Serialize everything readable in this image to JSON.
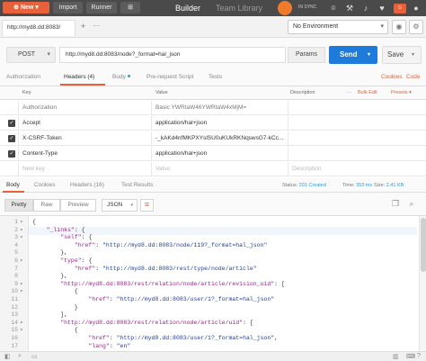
{
  "topbar": {
    "new_label": "New",
    "import_label": "Import",
    "runner_label": "Runner",
    "newtab_label": "⊞",
    "builder_label": "Builder",
    "team_library_label": "Team Library",
    "sync_label": "IN SYNC"
  },
  "request_tab": {
    "label": "http://myd8.dd:8083/",
    "add_label": "+",
    "more_label": "···"
  },
  "environment": {
    "selected": "No Environment"
  },
  "request": {
    "method": "POST",
    "url": "http://myd8.dd:8083/node?_format=hal_json",
    "params_label": "Params",
    "send_label": "Send",
    "save_label": "Save"
  },
  "request_tabs": {
    "authorization": "Authorization",
    "headers": "Headers (4)",
    "body": "Body",
    "prerequest": "Pre-request Script",
    "tests": "Tests",
    "cookies": "Cookies",
    "code": "Code"
  },
  "headers_table": {
    "col_key": "Key",
    "col_value": "Value",
    "col_description": "Description",
    "more": "···",
    "bulk_edit": "Bulk Edit",
    "presets": "Presets ▾",
    "rows": [
      {
        "key": "Authorization",
        "value": "Basic YWRtaW46YWRtaW4xMjM=",
        "checked": false
      },
      {
        "key": "Accept",
        "value": "application/hal+json",
        "checked": true
      },
      {
        "key": "X-CSRF-Token",
        "value": "-_kAKd4nfMKPXYslSU0uKUkRKNqswsG7-kCc...",
        "checked": true
      },
      {
        "key": "Content-Type",
        "value": "application/hal+json",
        "checked": true
      }
    ],
    "placeholder_key": "New key",
    "placeholder_value": "Value",
    "placeholder_description": "Description"
  },
  "response_tabs": {
    "body": "Body",
    "cookies": "Cookies",
    "headers": "Headers (16)",
    "tests": "Test Results",
    "status_label": "Status:",
    "status_value": "201 Created",
    "time_label": "Time:",
    "time_value": "353 ms",
    "size_label": "Size:",
    "size_value": "2.41 KB"
  },
  "response_toolbar": {
    "pretty": "Pretty",
    "raw": "Raw",
    "preview": "Preview",
    "format": "JSON"
  },
  "code_lines": [
    {
      "n": "1",
      "fold": "▾",
      "text": "{"
    },
    {
      "n": "2",
      "fold": "▾",
      "text": "    \"_links\": {"
    },
    {
      "n": "3",
      "fold": "▾",
      "text": "        \"self\": {"
    },
    {
      "n": "4",
      "fold": "",
      "text": "            \"href\": \"http://myd8.dd:8083/node/119?_format=hal_json\""
    },
    {
      "n": "5",
      "fold": "",
      "text": "        },"
    },
    {
      "n": "6",
      "fold": "▾",
      "text": "        \"type\": {"
    },
    {
      "n": "7",
      "fold": "",
      "text": "            \"href\": \"http://myd8.dd:8083/rest/type/node/article\""
    },
    {
      "n": "8",
      "fold": "",
      "text": "        },"
    },
    {
      "n": "9",
      "fold": "▾",
      "text": "        \"http://myd8.dd:8083/rest/relation/node/article/revision_uid\": ["
    },
    {
      "n": "10",
      "fold": "▾",
      "text": "            {"
    },
    {
      "n": "11",
      "fold": "",
      "text": "                \"href\": \"http://myd8.dd:8083/user/1?_format=hal_json\""
    },
    {
      "n": "12",
      "fold": "",
      "text": "            }"
    },
    {
      "n": "13",
      "fold": "",
      "text": "        ],"
    },
    {
      "n": "14",
      "fold": "▾",
      "text": "        \"http://myd8.dd:8083/rest/relation/node/article/uid\": ["
    },
    {
      "n": "15",
      "fold": "▾",
      "text": "            {"
    },
    {
      "n": "16",
      "fold": "",
      "text": "                \"href\": \"http://myd8.dd:8083/user/1?_format=hal_json\","
    },
    {
      "n": "17",
      "fold": "",
      "text": "                \"lang\": \"en\""
    }
  ],
  "colors": {
    "accent": "#e8613a",
    "send": "#1f7bd9",
    "status": "#2aa0d8"
  }
}
